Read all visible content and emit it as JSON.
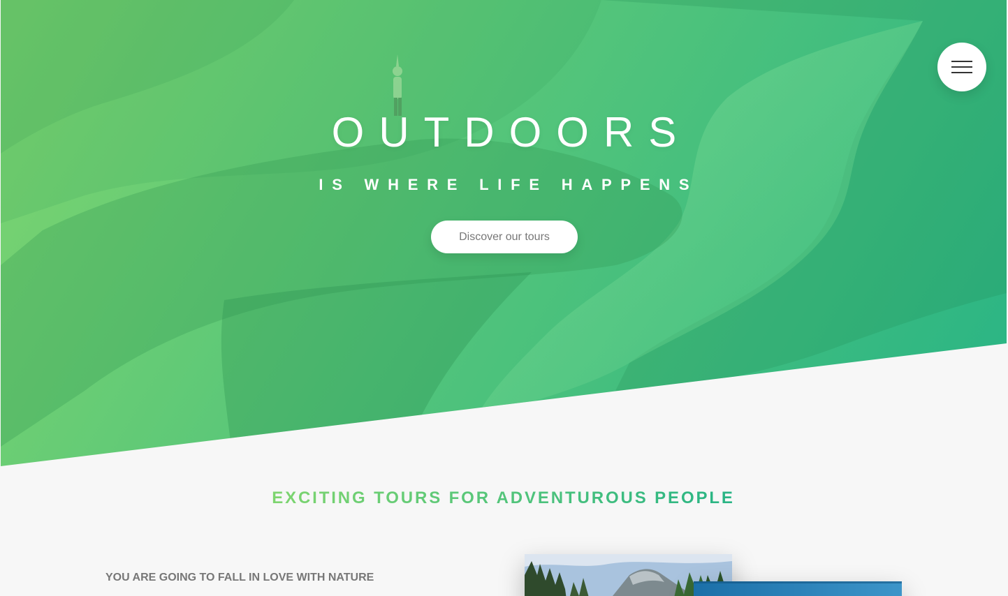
{
  "hero": {
    "title": "OUTDOORS",
    "subtitle": "IS WHERE LIFE HAPPENS",
    "cta_label": "Discover our tours",
    "gradient_colors": [
      "#7ed56f",
      "#55c57a",
      "#28b485"
    ]
  },
  "navigation": {
    "menu_icon": "hamburger-menu-icon"
  },
  "about": {
    "heading": "EXCITING TOURS FOR ADVENTUROUS PEOPLE",
    "subheading": "YOU ARE GOING TO FALL IN LOVE WITH NATURE"
  },
  "theme": {
    "accent": "#55c57a",
    "background": "#f7f7f7",
    "text_gray": "#777777"
  }
}
